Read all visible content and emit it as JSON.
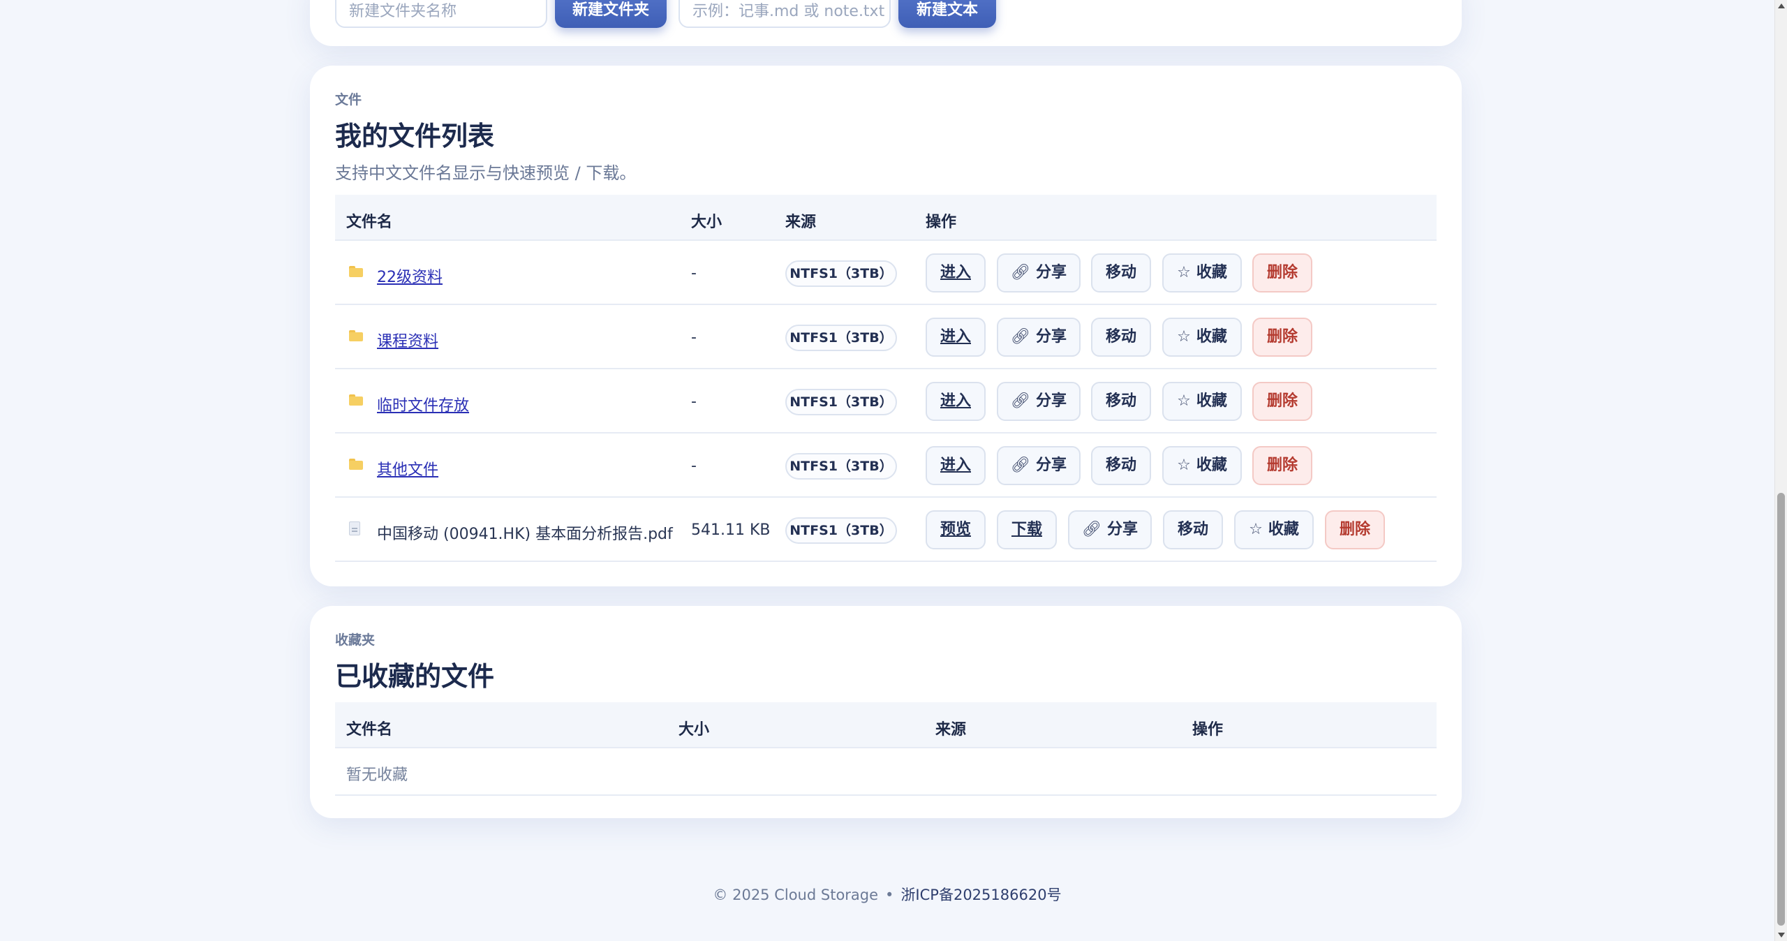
{
  "create": {
    "folder_placeholder": "新建文件夹名称",
    "folder_button": "新建文件夹",
    "text_placeholder": "示例：记事.md 或 note.txt",
    "text_button": "新建文本"
  },
  "files_section": {
    "eyebrow": "文件",
    "title": "我的文件列表",
    "subtitle": "支持中文文件名显示与快速预览 / 下载。",
    "columns": [
      "文件名",
      "大小",
      "来源",
      "操作"
    ],
    "rows": [
      {
        "type": "folder",
        "name": "22级资料",
        "size": "-",
        "source": "NTFS1（3TB）"
      },
      {
        "type": "folder",
        "name": "课程资料",
        "size": "-",
        "source": "NTFS1（3TB）"
      },
      {
        "type": "folder",
        "name": "临时文件存放",
        "size": "-",
        "source": "NTFS1（3TB）"
      },
      {
        "type": "folder",
        "name": "其他文件",
        "size": "-",
        "source": "NTFS1（3TB）"
      },
      {
        "type": "file",
        "name": "中国移动 (00941.HK) 基本面分析报告.pdf",
        "size": "541.11 KB",
        "source": "NTFS1（3TB）"
      }
    ],
    "actions": {
      "enter": "进入",
      "preview": "预览",
      "download": "下载",
      "share": "分享",
      "move": "移动",
      "favorite": "收藏",
      "delete": "删除"
    }
  },
  "favorites_section": {
    "eyebrow": "收藏夹",
    "title": "已收藏的文件",
    "columns": [
      "文件名",
      "大小",
      "来源",
      "操作"
    ],
    "empty_text": "暂无收藏"
  },
  "footer": {
    "copyright": "© 2025 Cloud Storage",
    "separator": "•",
    "icp": "浙ICP备2025186620号"
  },
  "icons": {
    "folder": "folder-icon",
    "file": "file-icon",
    "share": "link-icon",
    "favorite": "star-icon"
  },
  "colors": {
    "primary": "#4a6bc4",
    "danger": "#b43a2f",
    "link": "#2a2fb5"
  }
}
